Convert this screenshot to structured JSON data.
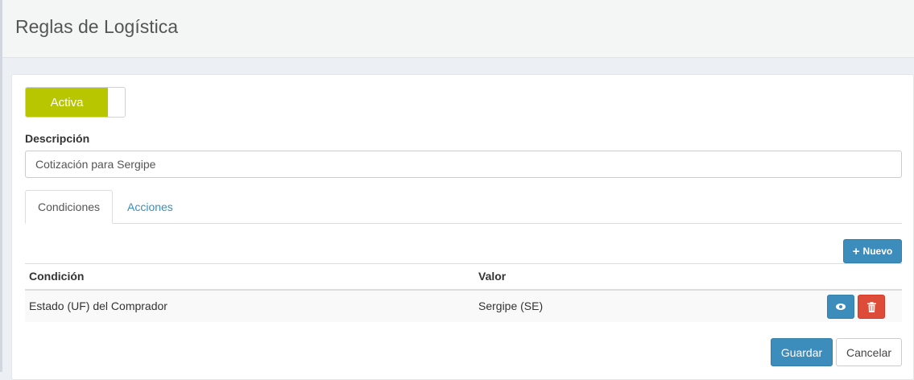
{
  "page": {
    "title": "Reglas de Logística"
  },
  "form": {
    "status_toggle": {
      "label": "Activa",
      "on": true
    },
    "description": {
      "label": "Descripción",
      "value": "Cotización para Sergipe"
    }
  },
  "tabs": [
    {
      "label": "Condiciones",
      "active": true
    },
    {
      "label": "Acciones",
      "active": false
    }
  ],
  "conditions": {
    "new_button_label": "Nuevo",
    "columns": [
      "Condición",
      "Valor"
    ],
    "rows": [
      {
        "condition": "Estado (UF) del Comprador",
        "value": "Sergipe (SE)"
      }
    ]
  },
  "actions": {
    "save_label": "Guardar",
    "cancel_label": "Cancelar"
  },
  "icons": {
    "plus": "plus-icon",
    "view": "eye-icon",
    "delete": "trash-icon"
  },
  "colors": {
    "toggle_on": "#b8c600",
    "primary": "#3c8dbc",
    "danger": "#dd4b39"
  }
}
